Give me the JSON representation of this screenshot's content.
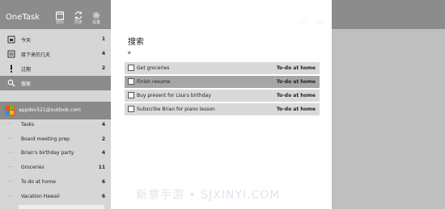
{
  "app": {
    "title": "OneTask"
  },
  "toolbar": {
    "calendar_label": "日历",
    "sync_label": "同步",
    "settings_label": "设置",
    "view_label": "查看",
    "sort_label": "排序"
  },
  "sidebar": {
    "smart_lists": [
      {
        "label": "今天",
        "count": "1"
      },
      {
        "label": "接下来的几天",
        "count": "4"
      },
      {
        "label": "过期",
        "count": "2"
      },
      {
        "label": "搜索",
        "count": ""
      }
    ],
    "account": "appdev521@outlook.com",
    "lists": [
      {
        "label": "Tasks",
        "count": "4"
      },
      {
        "label": "Board meeting prep",
        "count": "2"
      },
      {
        "label": "Brian's birthday party",
        "count": "4"
      },
      {
        "label": "Groceries",
        "count": "11"
      },
      {
        "label": "To-do at home",
        "count": "6"
      },
      {
        "label": "Vacation Hawaii",
        "count": "6"
      }
    ]
  },
  "main": {
    "title": "搜索",
    "search_value": "e",
    "tasks": [
      {
        "title": "Get groceries",
        "list": "To-do at home"
      },
      {
        "title": "Finish resume",
        "list": "To-do at home"
      },
      {
        "title": "Buy present for Lisa's birthday",
        "list": "To-do at home"
      },
      {
        "title": "Subscribe Brian for piano lesson",
        "list": "To-do at home"
      }
    ]
  },
  "watermark": "新意手游 • SJXINYI.COM"
}
